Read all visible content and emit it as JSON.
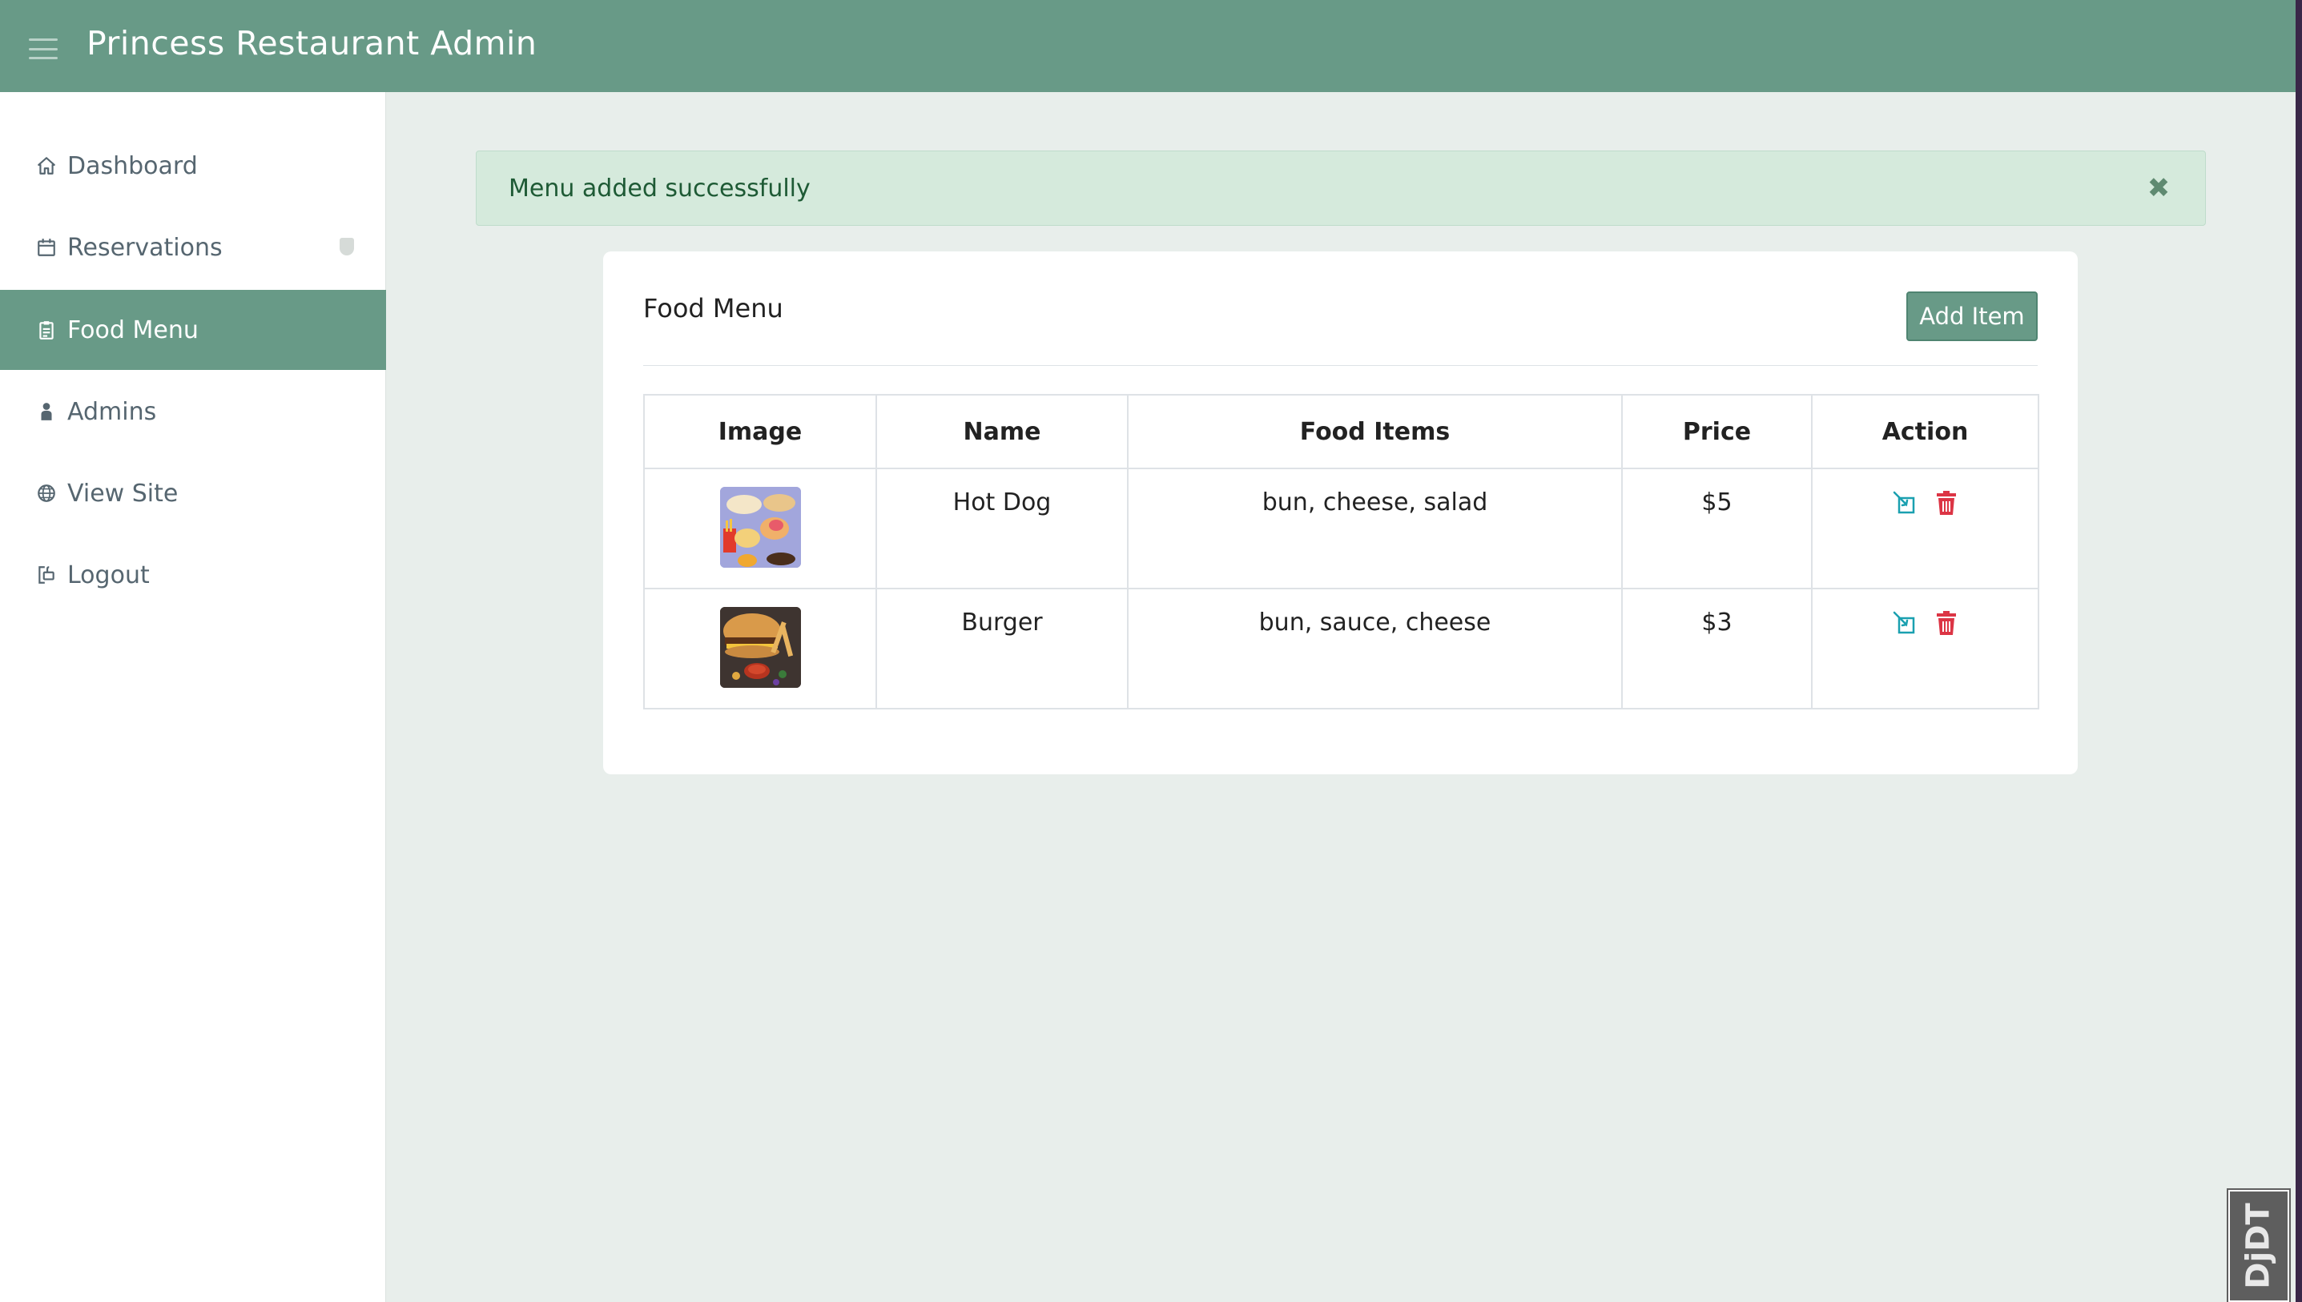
{
  "app": {
    "title": "Princess Restaurant Admin"
  },
  "sidebar": {
    "items": [
      {
        "label": "Dashboard",
        "icon": "home-icon"
      },
      {
        "label": "Reservations",
        "icon": "calendar-icon"
      },
      {
        "label": "Food Menu",
        "icon": "clipboard-icon",
        "active": true
      },
      {
        "label": "Admins",
        "icon": "user-icon"
      },
      {
        "label": "View Site",
        "icon": "globe-icon"
      },
      {
        "label": "Logout",
        "icon": "logout-icon"
      }
    ]
  },
  "alert": {
    "message": "Menu added successfully",
    "close_icon": "close-icon"
  },
  "card": {
    "title": "Food Menu",
    "add_button": "Add Item",
    "table": {
      "headers": [
        "Image",
        "Name",
        "Food Items",
        "Price",
        "Action"
      ],
      "rows": [
        {
          "image": "hot-dog-thumbnail",
          "name": "Hot Dog",
          "items": "bun, cheese, salad",
          "price": "$5"
        },
        {
          "image": "burger-thumbnail",
          "name": "Burger",
          "items": "bun, sauce, cheese",
          "price": "$3"
        }
      ]
    }
  },
  "debug_toolbar": {
    "label": "DjDT"
  },
  "colors": {
    "primary": "#689a87",
    "alert_bg": "#d5eadc",
    "edit_icon": "#1aa0b0",
    "delete_icon": "#dc3545"
  }
}
